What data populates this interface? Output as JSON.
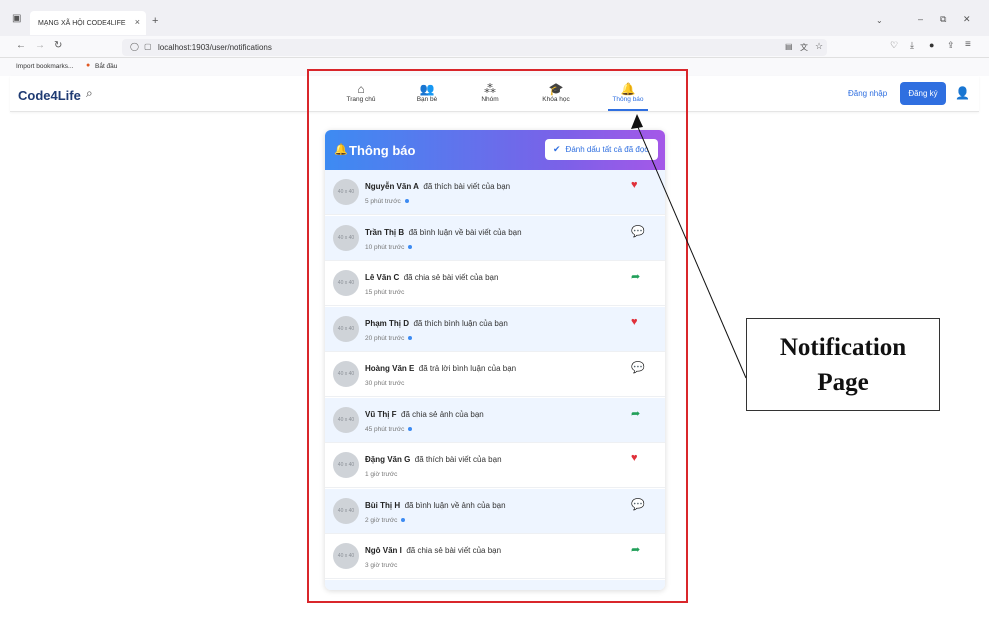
{
  "browser": {
    "tab_title": "MẠNG XÃ HỘI CODE4LIFE",
    "tab_close": "×",
    "new_tab": "+",
    "url": "localhost:1903/user/notifications",
    "bookmarks": [
      "Import bookmarks...",
      "Bắt đầu"
    ]
  },
  "header": {
    "logo": "Code4Life",
    "nav": [
      {
        "label": "Trang chủ",
        "icon": "home-icon",
        "glyph": "🏠"
      },
      {
        "label": "Bạn bè",
        "icon": "friends-icon",
        "glyph": "👥"
      },
      {
        "label": "Nhóm",
        "icon": "group-icon",
        "glyph": "👪"
      },
      {
        "label": "Khóa học",
        "icon": "graduation-cap-icon",
        "glyph": "🎓"
      },
      {
        "label": "Thông báo",
        "icon": "bell-icon",
        "glyph": "🔔",
        "active": true
      }
    ],
    "login_label": "Đăng nhập",
    "register_label": "Đăng ký"
  },
  "panel": {
    "title": "Thông báo",
    "mark_all_label": "Đánh dấu tất cả đã đọc"
  },
  "notifications": [
    {
      "name": "Nguyễn Văn A",
      "action": "đã thích bài viết của bạn",
      "time": "5 phút trước",
      "unread": true,
      "type": "like",
      "avatar": "40 x 40"
    },
    {
      "name": "Trần Thị B",
      "action": "đã bình luận về bài viết của bạn",
      "time": "10 phút trước",
      "unread": true,
      "type": "comment",
      "avatar": "40 x 40"
    },
    {
      "name": "Lê Văn C",
      "action": "đã chia sẻ bài viết của bạn",
      "time": "15 phút trước",
      "unread": false,
      "type": "share",
      "avatar": "40 x 40"
    },
    {
      "name": "Phạm Thị D",
      "action": "đã thích bình luận của bạn",
      "time": "20 phút trước",
      "unread": true,
      "type": "like",
      "avatar": "40 x 40"
    },
    {
      "name": "Hoàng Văn E",
      "action": "đã trả lời bình luận của bạn",
      "time": "30 phút trước",
      "unread": false,
      "type": "comment",
      "avatar": "40 x 40"
    },
    {
      "name": "Vũ Thị F",
      "action": "đã chia sẻ ảnh của bạn",
      "time": "45 phút trước",
      "unread": true,
      "type": "share",
      "avatar": "40 x 40"
    },
    {
      "name": "Đặng Văn G",
      "action": "đã thích bài viết của bạn",
      "time": "1 giờ trước",
      "unread": false,
      "type": "like",
      "avatar": "40 x 40"
    },
    {
      "name": "Bùi Thị H",
      "action": "đã bình luận về ảnh của bạn",
      "time": "2 giờ trước",
      "unread": true,
      "type": "comment",
      "avatar": "40 x 40"
    },
    {
      "name": "Ngô Văn I",
      "action": "đã chia sẻ bài viết của bạn",
      "time": "3 giờ trước",
      "unread": false,
      "type": "share",
      "avatar": "40 x 40"
    }
  ],
  "annotation": {
    "line1": "Notification",
    "line2": "Page"
  },
  "colors": {
    "accent": "#2f6fe0",
    "like": "#e0303a",
    "comment": "#2f6fe0",
    "share": "#22a05a",
    "highlight_box": "#d9262b"
  }
}
